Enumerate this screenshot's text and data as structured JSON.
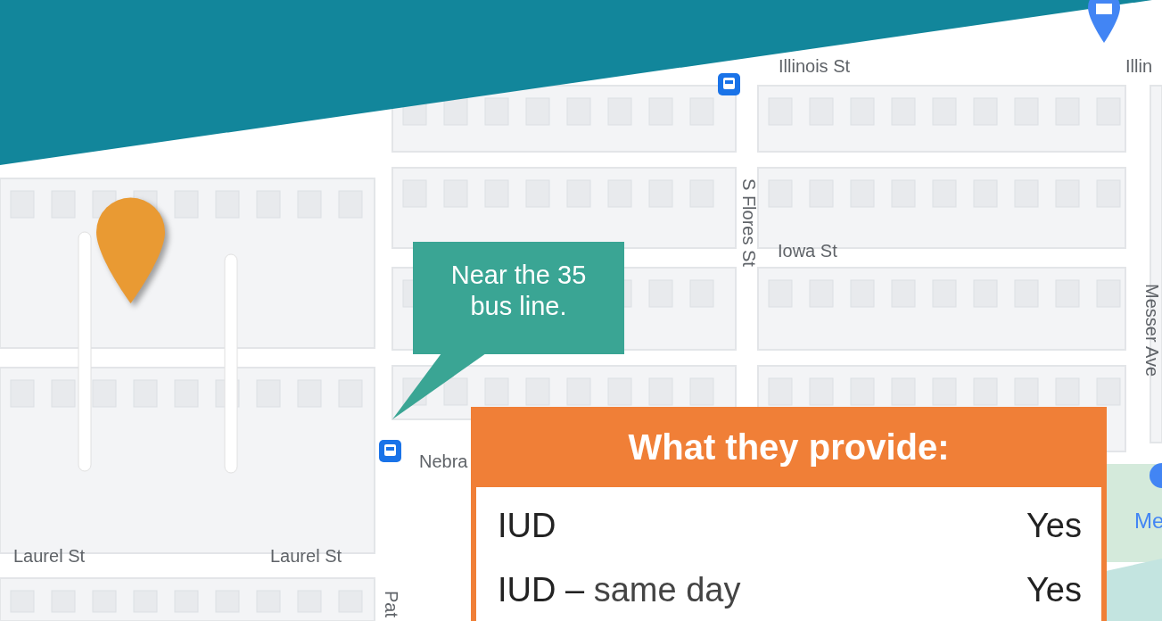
{
  "map": {
    "streets": [
      {
        "name": "Illinois St"
      },
      {
        "name": "Illin"
      },
      {
        "name": "S Flores St"
      },
      {
        "name": "Iowa St"
      },
      {
        "name": "Messer Ave"
      },
      {
        "name": "Nebra"
      },
      {
        "name": "Laurel St"
      },
      {
        "name": "Laurel St"
      },
      {
        "name": "Pat"
      }
    ],
    "place_label": "Me"
  },
  "callout": {
    "text": "Near the 35 bus line."
  },
  "provide": {
    "title": "What they provide:",
    "rows": [
      {
        "label": "IUD",
        "value": "Yes"
      },
      {
        "label": "IUD –",
        "note": "same day",
        "value": "Yes"
      }
    ]
  }
}
